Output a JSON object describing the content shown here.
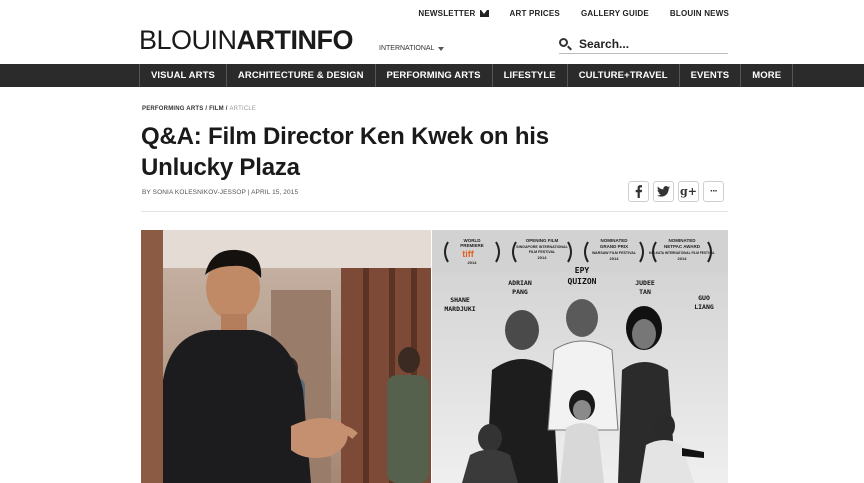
{
  "top_links": {
    "newsletter": "NEWSLETTER",
    "art_prices": "ART PRICES",
    "gallery_guide": "GALLERY GUIDE",
    "blouin_news": "BLOUIN NEWS"
  },
  "logo": {
    "part1": "BLOUIN",
    "part2": "ARTINFO"
  },
  "edition": "INTERNATIONAL",
  "search": {
    "placeholder": "Search..."
  },
  "nav": [
    "VISUAL ARTS",
    "ARCHITECTURE & DESIGN",
    "PERFORMING ARTS",
    "LIFESTYLE",
    "CULTURE+TRAVEL",
    "EVENTS",
    "MORE"
  ],
  "breadcrumb": {
    "section": "PERFORMING ARTS",
    "subsection": "FILM",
    "current": "ARTICLE"
  },
  "article": {
    "title": "Q&A: Film Director Ken Kwek on his Unlucky Plaza",
    "byline": "BY SONIA KOLESNIKOV-JESSOP | APRIL 15, 2015"
  },
  "share": {
    "facebook": "f",
    "twitter": "t",
    "google_plus": "g+",
    "more": "···"
  },
  "poster": {
    "laurels": [
      {
        "line1": "WORLD",
        "line2": "PREMIERE",
        "line3": "tiff",
        "year": "2014"
      },
      {
        "line1": "OPENING FILM",
        "line2": "SINGAPORE INTERNATIONAL",
        "line3": "FILM FESTIVAL",
        "year": "2014"
      },
      {
        "line1": "NOMINATED",
        "line2": "GRAND PRIX",
        "line3": "WARSAW FILM FESTIVAL",
        "year": "2014"
      },
      {
        "line1": "NOMINATED",
        "line2": "NETPAC AWARD",
        "line3": "KOLKATA INTERNATIONAL FILM FESTIVAL",
        "year": "2014"
      }
    ],
    "cast": [
      {
        "first": "SHANE",
        "last": "MARDJUKI"
      },
      {
        "first": "ADRIAN",
        "last": "PANG"
      },
      {
        "first": "EPY",
        "last": "QUIZON"
      },
      {
        "first": "JUDEE",
        "last": "TAN"
      },
      {
        "first": "GUO",
        "last": "LIANG"
      }
    ]
  },
  "colors": {
    "navbar": "#2b2b2b",
    "text": "#1a1a1a",
    "breadcrumb_current": "#999999"
  }
}
